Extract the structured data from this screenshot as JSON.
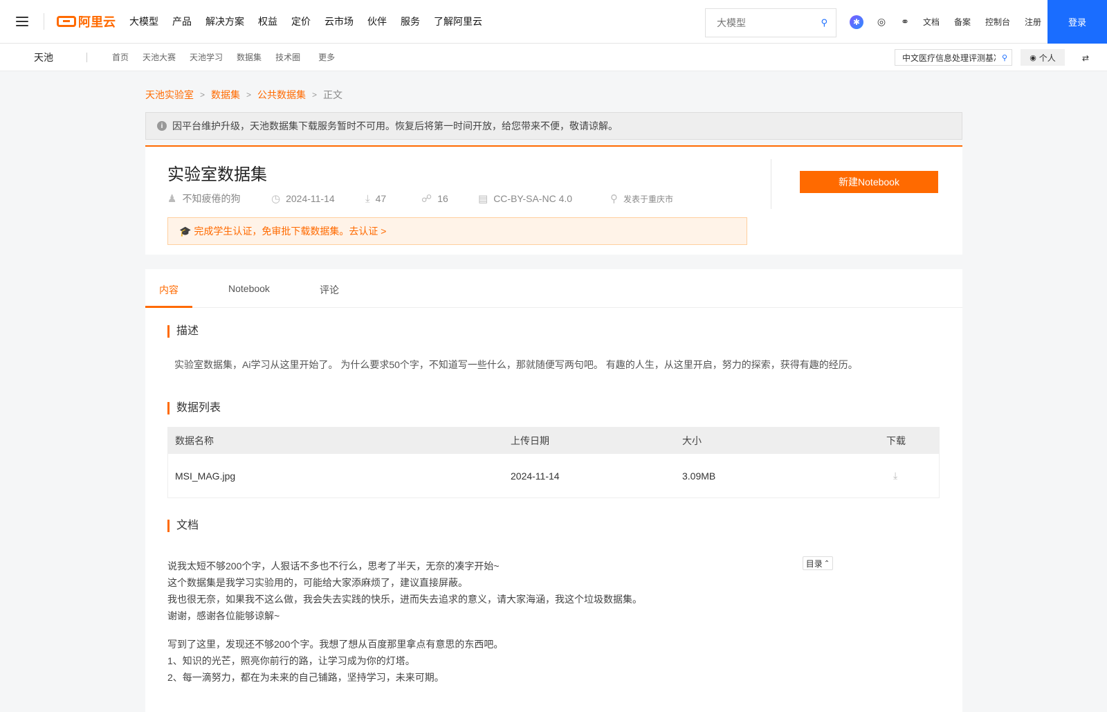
{
  "topnav": {
    "logo_text": "阿里云",
    "items": [
      "大模型",
      "产品",
      "解决方案",
      "权益",
      "定价",
      "云市场",
      "伙伴",
      "服务",
      "了解阿里云"
    ],
    "search_placeholder": "大模型",
    "links": [
      "文档",
      "备案",
      "控制台",
      "注册"
    ],
    "login_label": "登录"
  },
  "subnav": {
    "brand": "天池",
    "items": [
      "首页",
      "天池大赛",
      "天池学习",
      "数据集",
      "技术圈",
      "更多"
    ],
    "search_value": "中文医疗信息处理评测基准",
    "personal_label": "个人"
  },
  "breadcrumb": {
    "items": [
      "天池实验室",
      "数据集",
      "公共数据集"
    ],
    "current": "正文"
  },
  "notice": "因平台维护升级，天池数据集下载服务暂时不可用。恢复后将第一时间开放，给您带来不便，敬请谅解。",
  "dataset": {
    "title": "实验室数据集",
    "author": "不知疲倦的狗",
    "date": "2024-11-14",
    "downloads": "47",
    "shares": "16",
    "license": "CC-BY-SA-NC 4.0",
    "location": "发表于重庆市",
    "cert_text": "🎓 完成学生认证，免审批下载数据集。去认证 >",
    "notebook_button": "新建Notebook"
  },
  "tabs": [
    "内容",
    "Notebook",
    "评论"
  ],
  "sections": {
    "desc_title": "描述",
    "desc_text": "实验室数据集，Ai学习从这里开始了。 为什么要求50个字，不知道写一些什么，那就随便写两句吧。 有趣的人生，从这里开启，努力的探索，获得有趣的经历。",
    "list_title": "数据列表",
    "doc_title": "文档"
  },
  "table": {
    "headers": [
      "数据名称",
      "上传日期",
      "大小",
      "下载"
    ],
    "rows": [
      {
        "name": "MSI_MAG.jpg",
        "date": "2024-11-14",
        "size": "3.09MB"
      }
    ]
  },
  "doc": {
    "para1": [
      "说我太短不够200个字，人狠话不多也不行么，思考了半天，无奈的凑字开始~",
      "这个数据集是我学习实验用的，可能给大家添麻烦了，建议直接屏蔽。",
      "我也很无奈，如果我不这么做，我会失去实践的快乐，进而失去追求的意义，请大家海涵，我这个垃圾数据集。",
      "谢谢，感谢各位能够谅解~"
    ],
    "para2": [
      "写到了这里，发现还不够200个字。我想了想从百度那里拿点有意思的东西吧。",
      "1、知识的光芒，照亮你前行的路，让学习成为你的灯塔。",
      "2、每一滴努力，都在为未来的自己铺路，坚持学习，未来可期。"
    ],
    "toc_label": "目录"
  },
  "colors": {
    "accent": "#ff6a00",
    "primary": "#1a6dff"
  }
}
